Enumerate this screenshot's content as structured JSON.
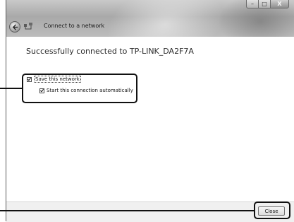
{
  "window": {
    "title": "Connect to a network",
    "caption": {
      "minimize": "–",
      "maximize": "□",
      "close": "X"
    }
  },
  "main": {
    "heading": "Successfully connected to TP-LINK_DA2F7A",
    "options": [
      {
        "label": "Save this network",
        "checked": true
      },
      {
        "label": "Start this connection automatically",
        "checked": true
      }
    ]
  },
  "footer": {
    "close_label": "Close"
  },
  "icons": {
    "back": "back-arrow-icon",
    "network": "network-icon"
  }
}
